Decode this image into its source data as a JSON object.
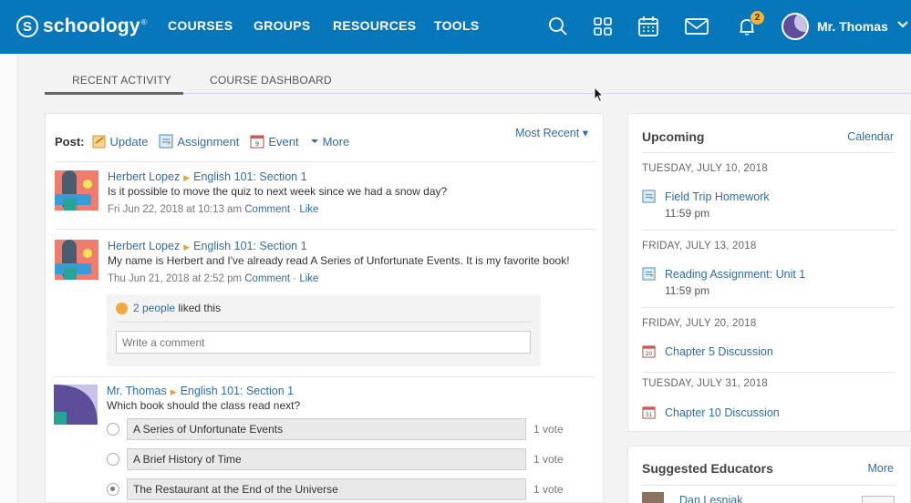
{
  "brand": {
    "name": "schoology",
    "mark": "S"
  },
  "nav": {
    "links": [
      "COURSES",
      "GROUPS",
      "RESOURCES",
      "TOOLS"
    ],
    "notification_count": "2",
    "user_name": "Mr. Thomas",
    "icons": [
      "search-icon",
      "apps-grid-icon",
      "calendar-icon",
      "mail-icon",
      "bell-icon",
      "chevron-down-icon"
    ],
    "brand_color": "#0677ba"
  },
  "tabs": [
    "RECENT ACTIVITY",
    "COURSE DASHBOARD"
  ],
  "composer": {
    "label": "Post:",
    "update": "Update",
    "assignment": "Assignment",
    "event": "Event",
    "more": "More",
    "sort": "Most Recent"
  },
  "feed": [
    {
      "author": "Herbert Lopez",
      "course": "English 101: Section 1",
      "text": "Is it possible to move the quiz to next week since we had a snow day?",
      "time": "Fri Jun 22, 2018 at 10:13 am",
      "comment": "Comment",
      "like": "Like"
    },
    {
      "author": "Herbert Lopez",
      "course": "English 101: Section 1",
      "text": "My name is Herbert and I've already read A Series of Unfortunate Events. It is my favorite book!",
      "time": "Thu Jun 21, 2018 at 2:52 pm",
      "comment": "Comment",
      "like": "Like",
      "likes_link": "2 people",
      "likes_suffix": "liked this",
      "comment_placeholder": "Write a comment"
    },
    {
      "author": "Mr. Thomas",
      "course": "English 101: Section 1",
      "text": "Which book should the class read next?",
      "poll": [
        {
          "option": "A Series of Unfortunate Events",
          "votes": "1 vote",
          "selected": false
        },
        {
          "option": "A Brief History of Time",
          "votes": "1 vote",
          "selected": false
        },
        {
          "option": "The Restaurant at the End of the Universe",
          "votes": "1 vote",
          "selected": true
        }
      ]
    }
  ],
  "upcoming": {
    "title": "Upcoming",
    "link": "Calendar",
    "groups": [
      {
        "date": "TUESDAY, JULY 10, 2018",
        "item": "Field Trip Homework",
        "time": "11:59 pm",
        "icon": "assignment-icon"
      },
      {
        "date": "FRIDAY, JULY 13, 2018",
        "item": "Reading Assignment: Unit 1",
        "time": "11:59 pm",
        "icon": "assignment-icon"
      },
      {
        "date": "FRIDAY, JULY 20, 2018",
        "item": "Chapter 5 Discussion",
        "icon": "calendar-event-icon",
        "day": "20"
      },
      {
        "date": "TUESDAY, JULY 31, 2018",
        "item": "Chapter 10 Discussion",
        "icon": "calendar-event-icon",
        "day": "31"
      }
    ]
  },
  "suggested": {
    "title": "Suggested Educators",
    "link": "More",
    "first_name": "Dan Lesniak"
  }
}
